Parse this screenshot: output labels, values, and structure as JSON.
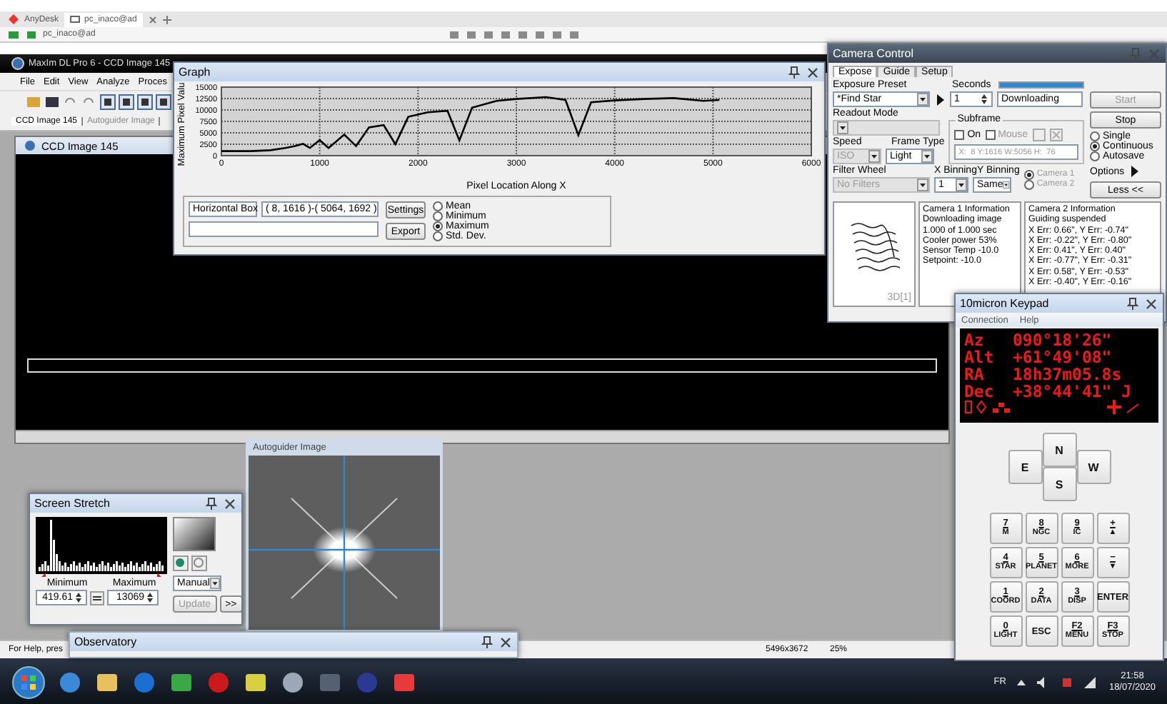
{
  "remote": {
    "app": "AnyDesk",
    "session_tab": "pc_inaco@ad",
    "address": "pc_inaco@ad"
  },
  "main": {
    "title": "MaxIm DL Pro 6 - CCD Image 145",
    "menu": [
      "File",
      "Edit",
      "View",
      "Analyze",
      "Proces"
    ],
    "tabs": [
      {
        "label": "CCD Image 145",
        "selected": true
      },
      {
        "label": "Autoguider Image",
        "selected": false
      }
    ],
    "image_title": "CCD Image 145",
    "status": {
      "help": "For Help, pres",
      "size": "5496x3672",
      "zoom": "25%"
    }
  },
  "graph": {
    "title": "Graph",
    "chart_data": {
      "type": "line",
      "xlabel": "Pixel Location Along X",
      "ylabel": "Maximum Pixel Valu",
      "x": [
        0,
        300,
        500,
        650,
        750,
        830,
        900,
        1000,
        1090,
        1250,
        1370,
        1500,
        1650,
        1770,
        1900,
        2100,
        2300,
        2420,
        2550,
        2800,
        3000,
        3300,
        3500,
        3630,
        3760,
        4000,
        4300,
        4600,
        4900,
        5064
      ],
      "grid": true,
      "series": [
        {
          "color": "#000000",
          "values": [
            1000,
            1000,
            1200,
            1700,
            2100,
            2600,
            1700,
            3400,
            1700,
            4600,
            2100,
            6200,
            6700,
            2500,
            8500,
            9500,
            9800,
            3300,
            10500,
            12000,
            12400,
            12800,
            12200,
            4500,
            11700,
            12100,
            12400,
            12600,
            12000,
            12200
          ]
        }
      ],
      "xlim": [
        0,
        6000
      ],
      "ylim": [
        0,
        15000
      ],
      "xticks": [
        0,
        1000,
        2000,
        3000,
        4000,
        5000,
        6000
      ],
      "yticks": [
        0,
        2500,
        5000,
        7500,
        10000,
        12500,
        15000
      ]
    },
    "region_type": "Horizontal Box",
    "region": "( 8, 1616 )-( 5064, 1692 )",
    "settings": "Settings",
    "export": "Export",
    "modes": [
      {
        "label": "Mean",
        "selected": false
      },
      {
        "label": "Minimum",
        "selected": false
      },
      {
        "label": "Maximum",
        "selected": true
      },
      {
        "label": "Std. Dev.",
        "selected": false
      }
    ]
  },
  "camera": {
    "title": "Camera Control",
    "tabs": [
      {
        "label": "Expose",
        "selected": true
      },
      {
        "label": "Guide",
        "selected": false
      },
      {
        "label": "Setup",
        "selected": false
      }
    ],
    "exposure_preset": {
      "label": "Exposure Preset",
      "value": "*Find Star"
    },
    "seconds": {
      "label": "Seconds",
      "value": "1"
    },
    "progress": {
      "level": 1,
      "status": "Downloading"
    },
    "readout_mode": {
      "label": "Readout Mode",
      "disabled": true
    },
    "subframe": {
      "label": "Subframe",
      "on": {
        "label": "On",
        "checked": false
      },
      "mouse": {
        "label": "Mouse",
        "checked": false,
        "disabled": true
      },
      "coords": "X:  8 Y:1616 W:5056 H:  76"
    },
    "speed": {
      "label": "Speed",
      "value": "ISO",
      "disabled": true
    },
    "frame_type": {
      "label": "Frame Type",
      "value": "Light"
    },
    "filter_wheel": {
      "label": "Filter Wheel",
      "value": "No Filters",
      "disabled": true
    },
    "x_binning": {
      "label": "X Binning",
      "value": "1"
    },
    "y_binning": {
      "label": "Y Binning",
      "value": "Same"
    },
    "cameras": [
      {
        "label": "Camera 1",
        "selected": true,
        "disabled": true
      },
      {
        "label": "Camera 2",
        "selected": false,
        "disabled": true
      }
    ],
    "start": {
      "label": "Start",
      "disabled": true
    },
    "stop": "Stop",
    "modes": [
      {
        "label": "Single",
        "selected": false
      },
      {
        "label": "Continuous",
        "selected": true
      },
      {
        "label": "Autosave",
        "selected": false
      }
    ],
    "options": "Options",
    "less": "Less <<",
    "preview_label": "3D[1]",
    "camera1_info": [
      "Camera 1 Information",
      "Downloading image",
      "1.000 of 1.000 sec",
      "Cooler power 53%",
      "Sensor Temp -10.0",
      "Setpoint: -10.0"
    ],
    "camera2_info": [
      "Camera 2 Information",
      "Guiding suspended",
      "X Err: 0.66\", Y Err: -0.74\"",
      "X Err: -0.22\", Y Err: -0.80\"",
      "X Err: 0.41\", Y Err: 0.40\"",
      "X Err: -0.77\", Y Err: -0.31\"",
      "X Err: 0.58\", Y Err: -0.53\"",
      "X Err: -0.40\", Y Err: -0.16\""
    ]
  },
  "keypad": {
    "title": "10micron Keypad",
    "menu": [
      "Connection",
      "Help"
    ],
    "display": [
      {
        "label": "Az",
        "value": "090°18'26\""
      },
      {
        "label": "Alt",
        "value": "+61°49'08\""
      },
      {
        "label": "RA",
        "value": "18h37m05.8s"
      },
      {
        "label": "Dec",
        "value": "+38°44'41\" J"
      }
    ],
    "north": "N",
    "east": "E",
    "west": "W",
    "south": "S",
    "keys": [
      {
        "main": "7",
        "sub": "M"
      },
      {
        "main": "8",
        "sub": "NGC"
      },
      {
        "main": "9",
        "sub": "IC"
      },
      {
        "main": "+",
        "sub": "▲"
      },
      {
        "main": "4",
        "sub": "STAR"
      },
      {
        "main": "5",
        "sub": "PLANET"
      },
      {
        "main": "6",
        "sub": "MORE"
      },
      {
        "main": "−",
        "sub": "▼"
      },
      {
        "main": "1",
        "sub": "COORD"
      },
      {
        "main": "2",
        "sub": "DATA"
      },
      {
        "main": "3",
        "sub": "DISP"
      },
      {
        "main": "ENTER"
      },
      {
        "main": "0",
        "sub": "LIGHT"
      },
      {
        "main": "ESC"
      },
      {
        "main": "F2",
        "sub": "MENU"
      },
      {
        "main": "F3",
        "sub": "STOP"
      }
    ]
  },
  "stretch": {
    "title": "Screen Stretch",
    "min_label": "Minimum",
    "max_label": "Maximum",
    "min": "419.61",
    "max": "13069",
    "mode": "Manual",
    "update": {
      "label": "Update",
      "disabled": true
    },
    "more": ">>"
  },
  "guider": {
    "title": "Autoguider Image"
  },
  "observatory": {
    "title": "Observatory"
  },
  "taskbar": {
    "language": "FR",
    "time": "21:58",
    "date": "18/07/2020"
  }
}
